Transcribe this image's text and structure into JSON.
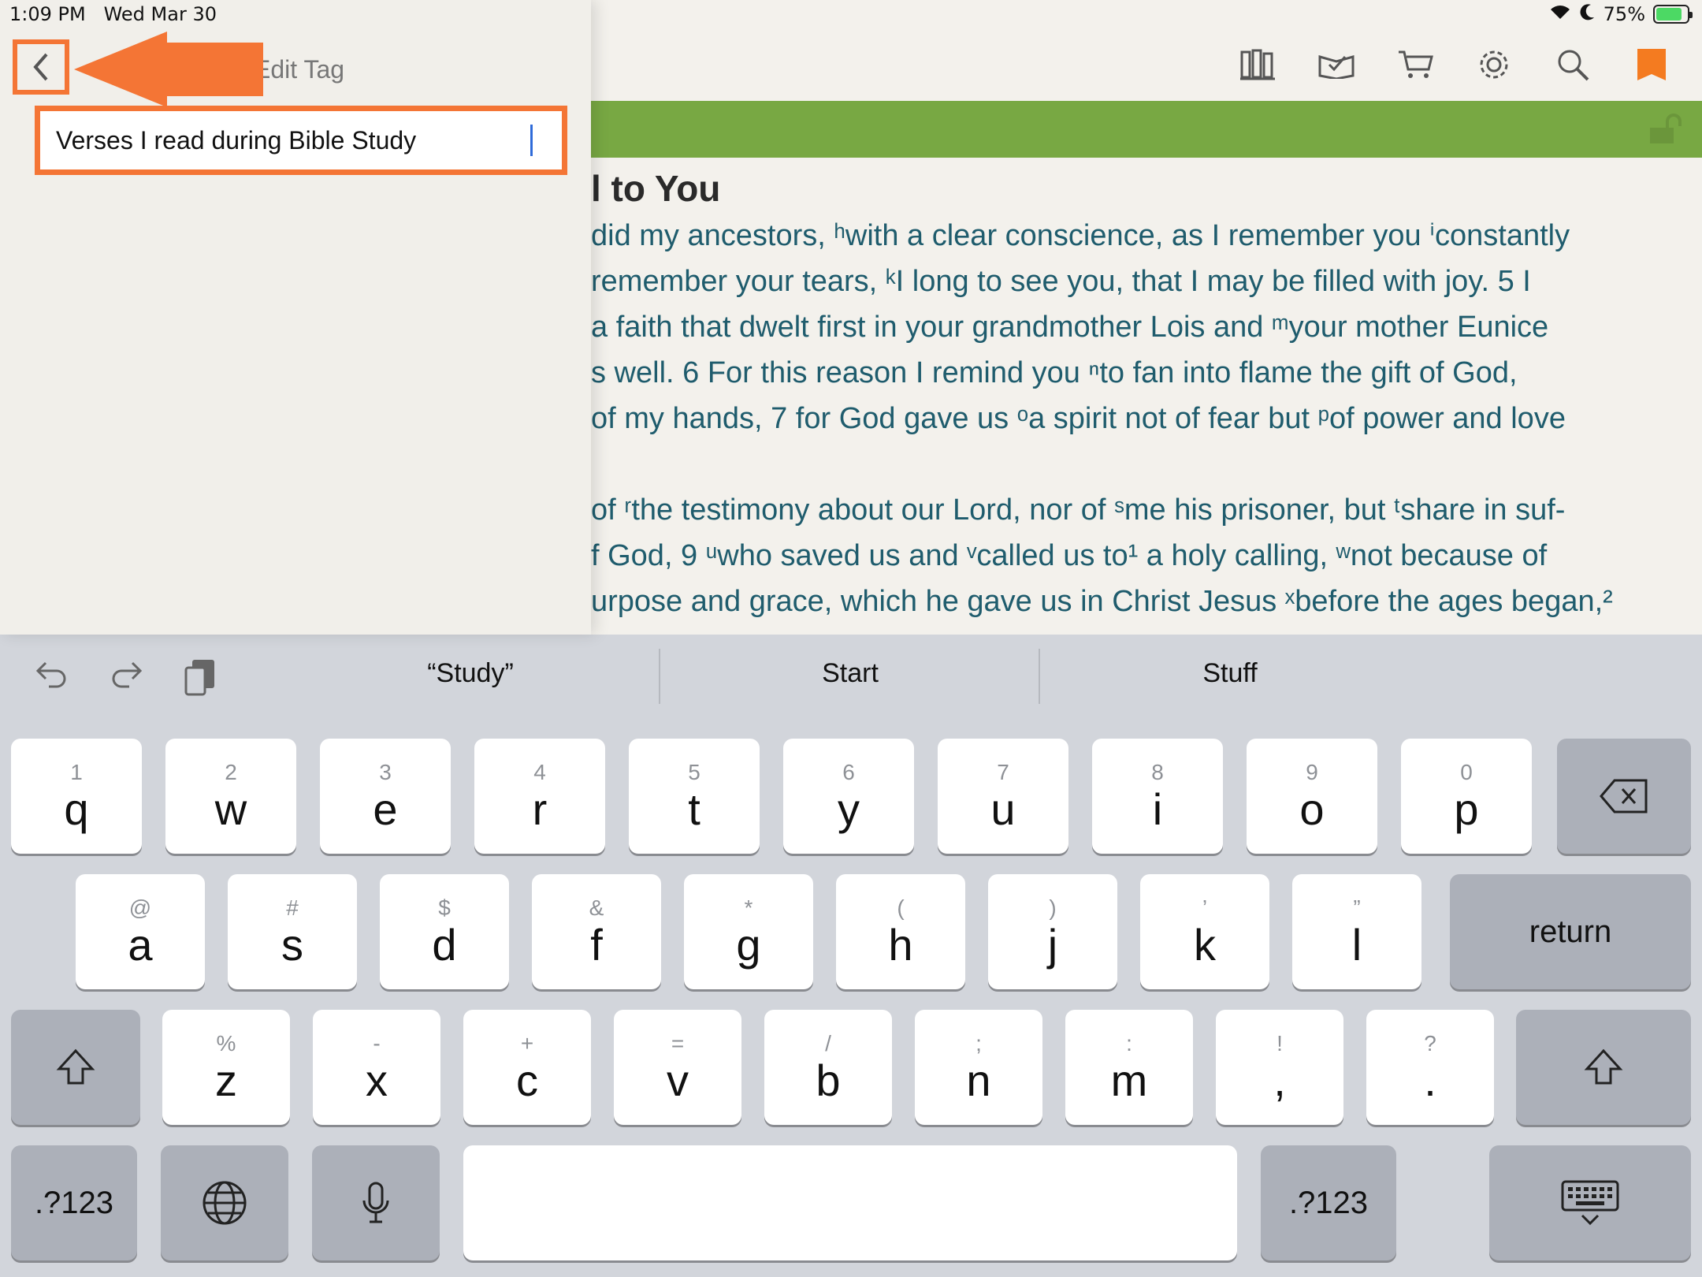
{
  "status": {
    "time": "1:09 PM",
    "date": "Wed Mar 30",
    "battery": "75%"
  },
  "sidebar": {
    "title": "Edit Tag",
    "tag_value": "Verses I read during  Bible Study"
  },
  "reading": {
    "heading": "l to You",
    "lines": [
      "did my ancestors, ʰwith a clear conscience, as I remember you ⁱconstantly",
      "remember your tears, ᵏI long to see you, that I may be filled with joy.  5  I",
      "a faith that dwelt first in your grandmother Lois and ᵐyour mother Eunice",
      "s well.  6  For this reason I remind you ⁿto fan into flame the gift of God,",
      " of my hands,  7  for God gave us ᵒa spirit not of fear but ᵖof power and love",
      "of ʳthe testimony about our Lord, nor of ˢme his prisoner, but ᵗshare in suf-",
      "f God,  9  ᵘwho saved us and ᵛcalled us to¹ a holy calling, ʷnot because of",
      "urpose and grace, which he gave us in Christ Jesus ˣbefore the ages began,²"
    ]
  },
  "keyboard": {
    "suggestions": [
      "“Study”",
      "Start",
      "Stuff"
    ],
    "row1": [
      {
        "alt": "1",
        "key": "q"
      },
      {
        "alt": "2",
        "key": "w"
      },
      {
        "alt": "3",
        "key": "e"
      },
      {
        "alt": "4",
        "key": "r"
      },
      {
        "alt": "5",
        "key": "t"
      },
      {
        "alt": "6",
        "key": "y"
      },
      {
        "alt": "7",
        "key": "u"
      },
      {
        "alt": "8",
        "key": "i"
      },
      {
        "alt": "9",
        "key": "o"
      },
      {
        "alt": "0",
        "key": "p"
      }
    ],
    "row2": [
      {
        "alt": "@",
        "key": "a"
      },
      {
        "alt": "#",
        "key": "s"
      },
      {
        "alt": "$",
        "key": "d"
      },
      {
        "alt": "&",
        "key": "f"
      },
      {
        "alt": "*",
        "key": "g"
      },
      {
        "alt": "(",
        "key": "h"
      },
      {
        "alt": ")",
        "key": "j"
      },
      {
        "alt": "’",
        "key": "k"
      },
      {
        "alt": "”",
        "key": "l"
      }
    ],
    "row3": [
      {
        "alt": "%",
        "key": "z"
      },
      {
        "alt": "-",
        "key": "x"
      },
      {
        "alt": "+",
        "key": "c"
      },
      {
        "alt": "=",
        "key": "v"
      },
      {
        "alt": "/",
        "key": "b"
      },
      {
        "alt": ";",
        "key": "n"
      },
      {
        "alt": ":",
        "key": "m"
      },
      {
        "alt": "!",
        "key": ","
      },
      {
        "alt": "?",
        "key": "."
      }
    ],
    "return_label": "return",
    "numbers_label": ".?123"
  }
}
